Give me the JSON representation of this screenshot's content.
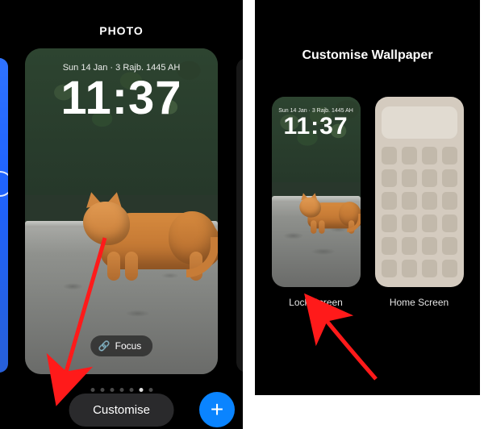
{
  "left": {
    "header": "PHOTO",
    "date": "Sun 14 Jan · 3 Rajb. 1445 AH",
    "time": "11:37",
    "focus_label": "Focus",
    "customise_label": "Customise",
    "add_label": "+",
    "dot_count": 7,
    "dot_active_index": 5
  },
  "right": {
    "header": "Customise Wallpaper",
    "date": "Sun 14 Jan · 3 Rajb. 1445 AH",
    "time": "11:37",
    "lock_label": "Lock Screen",
    "home_label": "Home Screen"
  },
  "colors": {
    "accent": "#0a84ff",
    "arrow": "#ff1a1a"
  }
}
